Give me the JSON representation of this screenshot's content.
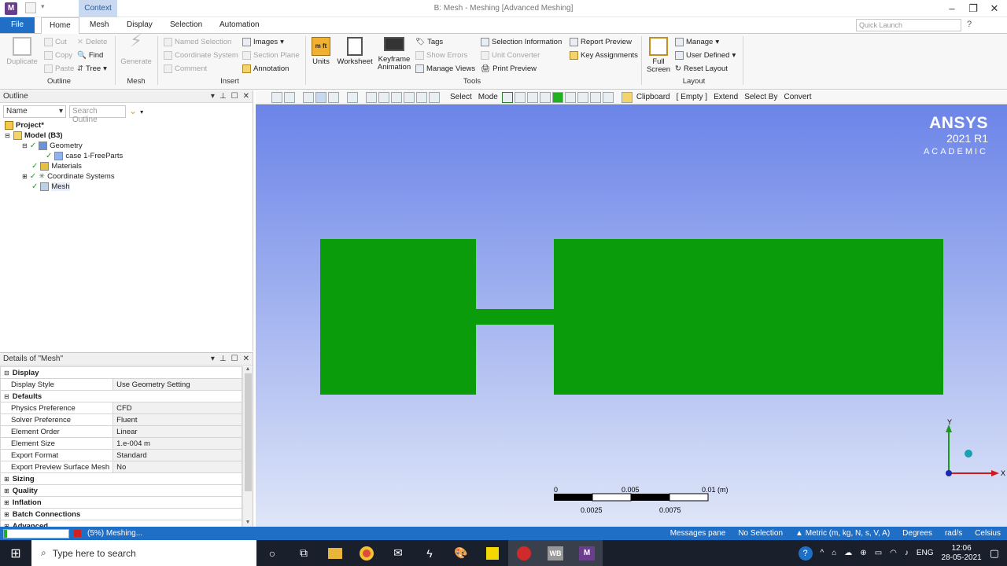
{
  "window": {
    "title": "B: Mesh - Meshing [Advanced Meshing]",
    "context_tab": "Context",
    "app_icon": "M",
    "controls": [
      "–",
      "❐",
      "✕"
    ]
  },
  "tabs": [
    "File",
    "Home",
    "Mesh",
    "Display",
    "Selection",
    "Automation"
  ],
  "quick_launch": {
    "placeholder": "Quick Launch"
  },
  "ribbon": {
    "outline": {
      "label": "Outline",
      "duplicate": "Duplicate",
      "cut": "Cut",
      "copy": "Copy",
      "paste": "Paste",
      "delete": "Delete",
      "find": "Find",
      "tree": "Tree"
    },
    "mesh": {
      "label": "Mesh",
      "generate": "Generate"
    },
    "insert": {
      "label": "Insert",
      "named_selection": "Named Selection",
      "coordinate_system": "Coordinate System",
      "comment": "Comment",
      "images": "Images",
      "section_plane": "Section Plane",
      "annotation": "Annotation"
    },
    "tools": {
      "label": "Tools",
      "units": "Units",
      "worksheet": "Worksheet",
      "keyframe_1": "Keyframe",
      "keyframe_2": "Animation",
      "tags": "Tags",
      "show_errors": "Show Errors",
      "manage_views": "Manage Views",
      "selection_information": "Selection Information",
      "unit_converter": "Unit Converter",
      "print_preview": "Print Preview",
      "report_preview": "Report Preview",
      "key_assignments": "Key Assignments"
    },
    "layout": {
      "label": "Layout",
      "full_1": "Full",
      "full_2": "Screen",
      "manage": "Manage",
      "user_defined": "User Defined",
      "reset_layout": "Reset Layout"
    }
  },
  "outline": {
    "title": "Outline",
    "name_filter": "Name",
    "search_placeholder": "Search Outline",
    "tree": [
      "Project*",
      "Model (B3)",
      "Geometry",
      "case 1-FreeParts",
      "Materials",
      "Coordinate Systems",
      "Mesh"
    ]
  },
  "details": {
    "title": "Details of \"Mesh\"",
    "rows": [
      {
        "type": "cat",
        "label": "Display"
      },
      {
        "type": "prop",
        "label": "Display Style",
        "value": "Use Geometry Setting"
      },
      {
        "type": "cat",
        "label": "Defaults"
      },
      {
        "type": "prop",
        "label": "Physics Preference",
        "value": "CFD"
      },
      {
        "type": "prop",
        "label": "Solver Preference",
        "value": "Fluent"
      },
      {
        "type": "prop",
        "label": "Element Order",
        "value": "Linear"
      },
      {
        "type": "prop",
        "label": "Element Size",
        "value": "1.e-004 m"
      },
      {
        "type": "prop",
        "label": "Export Format",
        "value": "Standard"
      },
      {
        "type": "prop",
        "label": "Export Preview Surface Mesh",
        "value": "No"
      },
      {
        "type": "cat",
        "label": "Sizing"
      },
      {
        "type": "cat",
        "label": "Quality"
      },
      {
        "type": "cat",
        "label": "Inflation"
      },
      {
        "type": "cat",
        "label": "Batch Connections"
      },
      {
        "type": "cat",
        "label": "Advanced"
      }
    ]
  },
  "viewport_toolbar": {
    "select": "Select",
    "mode": "Mode",
    "clipboard": "Clipboard",
    "empty": "[ Empty ]",
    "extend": "Extend",
    "select_by": "Select By",
    "convert": "Convert"
  },
  "brand": {
    "name": "ANSYS",
    "version": "2021 R1",
    "edition": "ACADEMIC"
  },
  "scale": {
    "t0": "0",
    "t1": "0.005",
    "t2": "0.01 (m)",
    "b1": "0.0025",
    "b2": "0.0075"
  },
  "triad": {
    "x": "X",
    "y": "Y"
  },
  "status": {
    "progress": 0.05,
    "message": "(5%) Meshing...",
    "messages_pane": "Messages pane",
    "selection": "No Selection",
    "units": "Metric (m, kg, N, s, V, A)",
    "degrees": "Degrees",
    "rad": "rad/s",
    "temp": "Celsius"
  },
  "taskbar": {
    "search_placeholder": "Type here to search",
    "lang": "ENG",
    "time": "12:06",
    "date": "28-05-2021",
    "wb": "WB",
    "m": "M"
  },
  "colors": {
    "accent": "#1f6fc6",
    "mesh": "#0a9c0a",
    "viewport_top": "#6b84e8",
    "viewport_bottom": "#dfe6f8"
  }
}
